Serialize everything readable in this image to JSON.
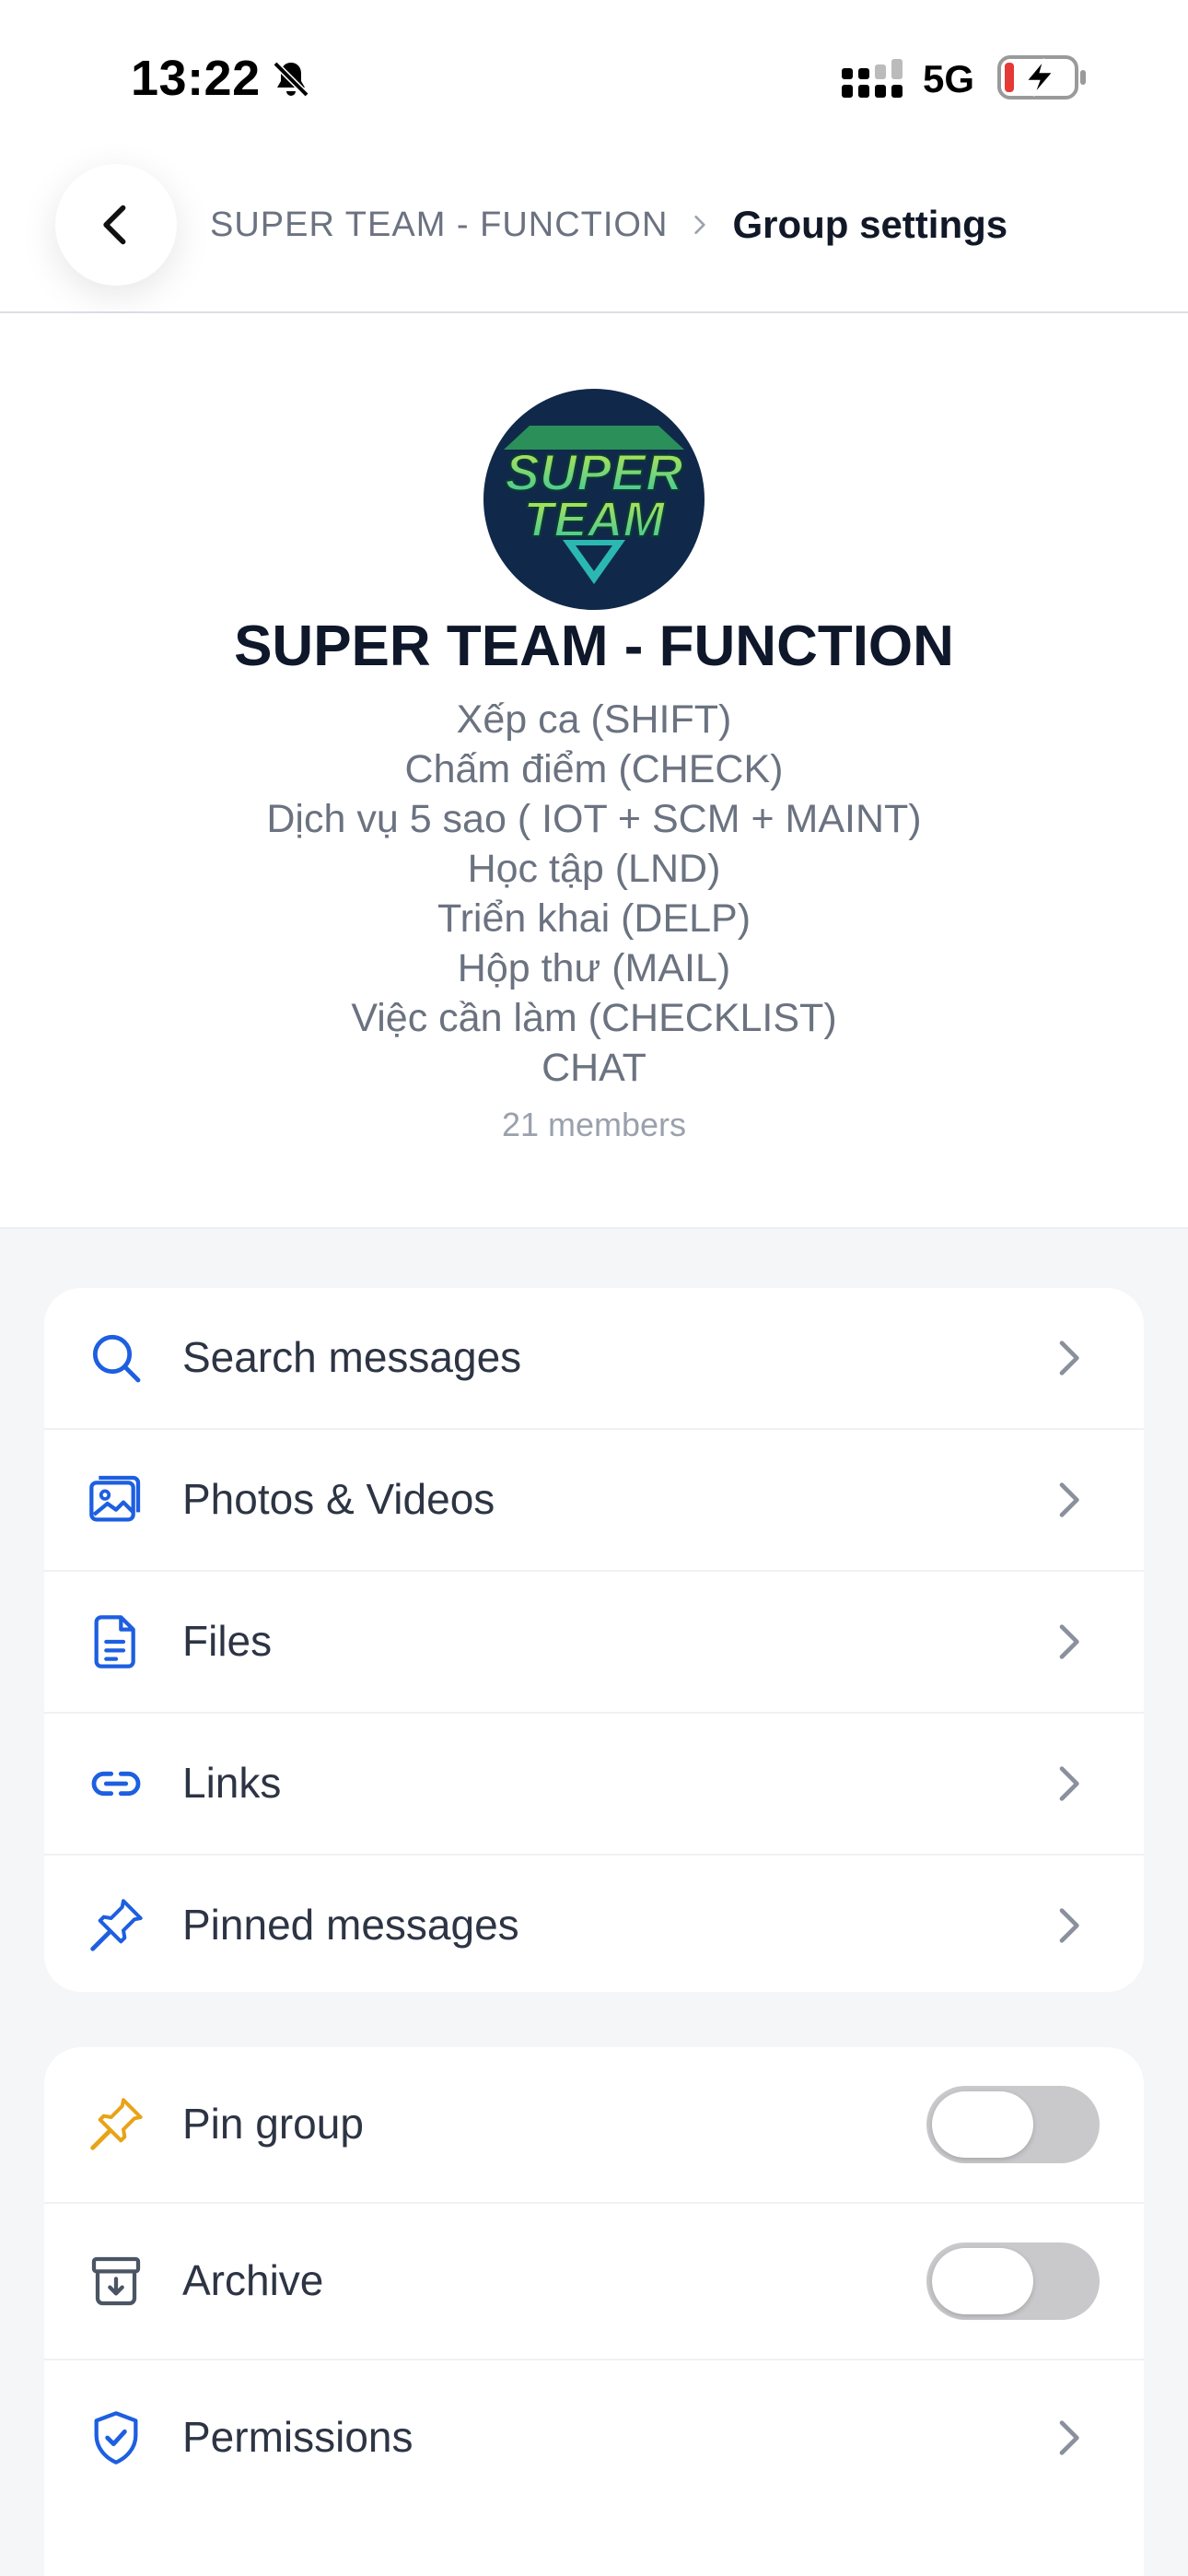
{
  "status_bar": {
    "time": "13:22",
    "network": "5G"
  },
  "header": {
    "breadcrumb_parent": "SUPER TEAM - FUNCTION",
    "breadcrumb_current": "Group settings"
  },
  "group": {
    "name": "SUPER TEAM - FUNCTION",
    "avatar_text_line1": "SUPER",
    "avatar_text_line2": "TEAM",
    "description_lines": [
      "Xếp ca (SHIFT)",
      "Chấm điểm (CHECK)",
      "Dịch vụ 5 sao ( IOT + SCM + MAINT)",
      "Học tập (LND)",
      "Triển khai (DELP)",
      "Hộp thư (MAIL)",
      "Việc cần làm (CHECKLIST)",
      "CHAT"
    ],
    "members": "21 members"
  },
  "menu": [
    {
      "label": "Search messages",
      "icon": "search-icon"
    },
    {
      "label": "Photos & Videos",
      "icon": "photos-icon"
    },
    {
      "label": "Files",
      "icon": "file-icon"
    },
    {
      "label": "Links",
      "icon": "link-icon"
    },
    {
      "label": "Pinned messages",
      "icon": "pin-icon"
    }
  ],
  "settings": [
    {
      "label": "Pin group",
      "icon": "pin-icon",
      "toggle": false
    },
    {
      "label": "Archive",
      "icon": "archive-icon",
      "toggle": false
    },
    {
      "label": "Permissions",
      "icon": "shield-icon"
    }
  ],
  "colors": {
    "accent": "#1d5fe0",
    "pin_group_icon": "#e8a317",
    "toggle_off": "#c9c9cc"
  }
}
